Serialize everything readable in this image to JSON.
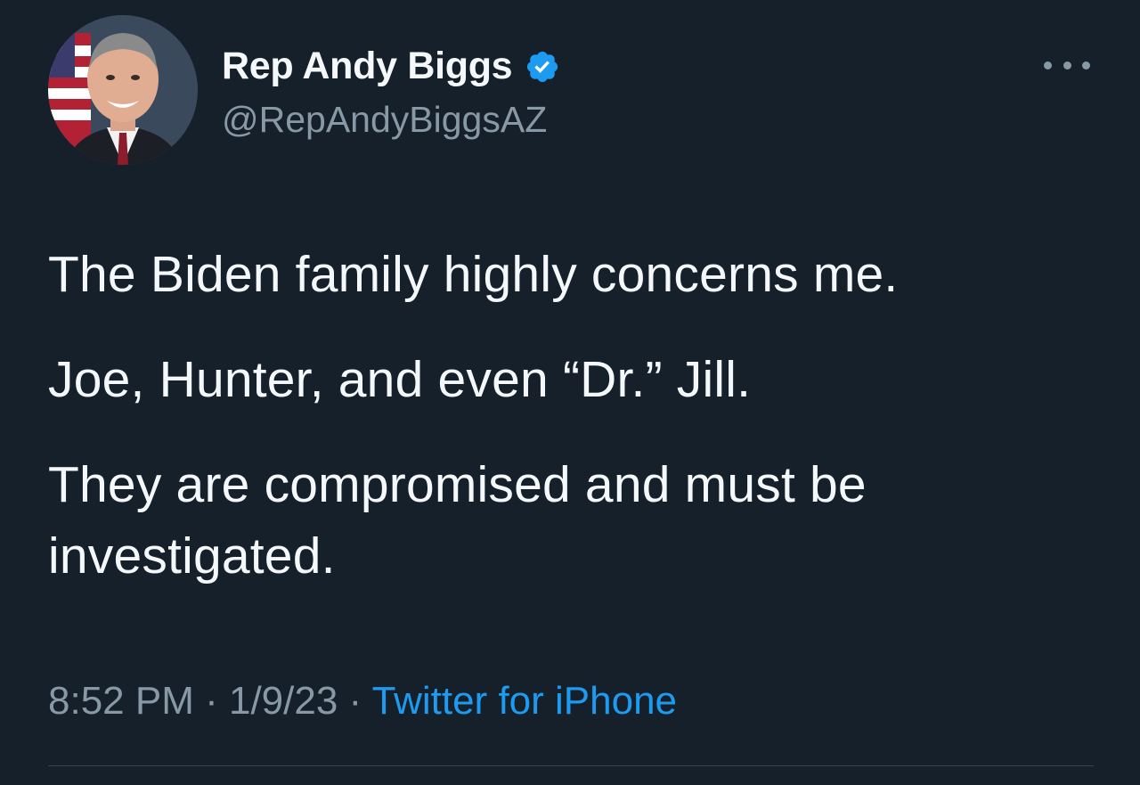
{
  "author": {
    "display_name": "Rep Andy Biggs",
    "handle": "@RepAndyBiggsAZ",
    "verified": true
  },
  "tweet": {
    "paragraphs": [
      "The Biden family highly concerns me.",
      "Joe, Hunter, and even “Dr.” Jill.",
      "They are compromised and must be investigated."
    ]
  },
  "meta": {
    "time": "8:52 PM",
    "separator": " · ",
    "date": "1/9/23",
    "source": "Twitter for iPhone"
  },
  "colors": {
    "background": "#15202b",
    "text": "#f5f8fa",
    "secondary": "#8899a6",
    "accent": "#1d9bf0"
  },
  "icons": {
    "verified": "verified-badge-icon",
    "more": "more-horizontal-icon"
  }
}
